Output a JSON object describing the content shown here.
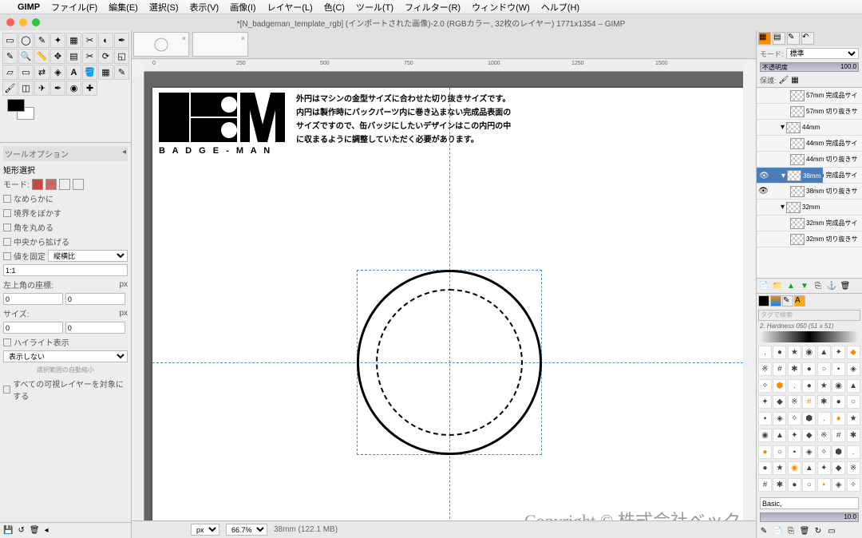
{
  "menubar": {
    "gimp": "GIMP",
    "items": [
      "ファイル(F)",
      "編集(E)",
      "選択(S)",
      "表示(V)",
      "画像(I)",
      "レイヤー(L)",
      "色(C)",
      "ツール(T)",
      "フィルター(R)",
      "ウィンドウ(W)",
      "ヘルプ(H)"
    ]
  },
  "window": {
    "title": "*[N_badgeman_template_rgb] (インポートされた画像)-2.0 (RGBカラー, 32枚のレイヤー) 1771x1354 – GIMP"
  },
  "tooloptions": {
    "header": "ツールオプション",
    "tool_name": "矩形選択",
    "mode": "モード:",
    "smooth": "なめらかに",
    "blur_border": "境界をぼかす",
    "round_corners": "角を丸める",
    "extend_center": "中央から拡げる",
    "fix_value": "値を固定",
    "fix_mode": "縦横比",
    "ratio": "1:1",
    "topleft": "左上角の座標:",
    "unit_px": "px",
    "x": "0",
    "y": "0",
    "size": "サイズ:",
    "w": "0",
    "h": "0",
    "highlight": "ハイライト表示",
    "show_none": "表示しない",
    "autoshrink": "選択範囲の自動縮小",
    "all_layers": "すべての可視レイヤーを対象にする"
  },
  "canvas": {
    "desc1": "外円はマシンの金型サイズに合わせた切り抜きサイズです。",
    "desc2": "内円は製作時にバックパーツ内に巻き込まない完成品表面の",
    "desc3": "サイズですので、缶バッジにしたいデザインはこの内円の中",
    "desc4": "に収まるように調整していただく必要があります。",
    "logo_sub": "B A D G E - M A N",
    "copyright": "Copyright © 株式会社ベック",
    "ruler_ticks": [
      "0",
      "250",
      "500",
      "750",
      "1000",
      "1250",
      "1500"
    ]
  },
  "statusbar": {
    "unit": "px",
    "zoom": "66.7%",
    "layer_info": "38mm (122.1 MB)"
  },
  "rightpanel": {
    "mode_label": "モード:",
    "mode_value": "標準",
    "opacity_label": "不透明度",
    "opacity_value": "100.0",
    "lock_label": "保護:"
  },
  "layers": [
    {
      "name": "57mm 完成品サイ",
      "indent": 2,
      "eye": false
    },
    {
      "name": "57mm 切り抜きサ",
      "indent": 2,
      "eye": false
    },
    {
      "name": "44mm",
      "indent": 1,
      "eye": false,
      "group": true,
      "expanded": true
    },
    {
      "name": "44mm 完成品サイ",
      "indent": 2,
      "eye": false
    },
    {
      "name": "44mm 切り抜きサ",
      "indent": 2,
      "eye": false
    },
    {
      "name": "38mm",
      "indent": 1,
      "eye": true,
      "group": true,
      "expanded": true,
      "selected": true
    },
    {
      "name": "38mm 完成品サイ",
      "indent": 2,
      "eye": true
    },
    {
      "name": "38mm 切り抜きサ",
      "indent": 2,
      "eye": true
    },
    {
      "name": "32mm",
      "indent": 1,
      "eye": false,
      "group": true,
      "expanded": true
    },
    {
      "name": "32mm 完成品サイ",
      "indent": 2,
      "eye": false
    },
    {
      "name": "32mm 切り抜きサ",
      "indent": 2,
      "eye": false
    }
  ],
  "brushes": {
    "search_placeholder": "タグで検索",
    "current": "2. Hardness 050 (51 x 51)",
    "preset": "Basic,",
    "size": "10.0"
  }
}
